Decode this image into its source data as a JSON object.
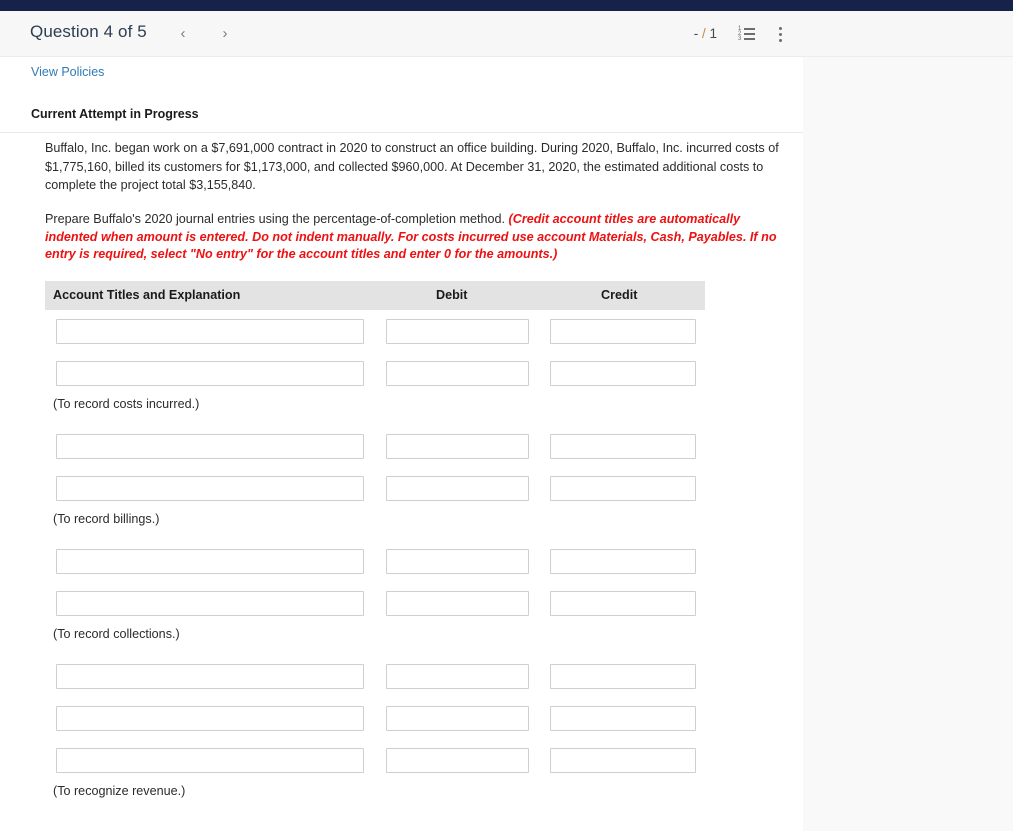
{
  "top_bar": {
    "color": "#16224a"
  },
  "header": {
    "title": "Question 4 of 5",
    "prev_label": "‹",
    "next_label": "›",
    "score_earned": "-",
    "score_separator": "/",
    "score_total": "1",
    "list_icon_name": "numbered-list-icon",
    "menu_icon_name": "kebab-menu-icon",
    "accent_color": "#c98a3a"
  },
  "content": {
    "view_policies_label": "View Policies",
    "attempt_status": "Current Attempt in Progress",
    "problem_text": "Buffalo, Inc. began work on a $7,691,000 contract in 2020 to construct an office building. During 2020, Buffalo, Inc. incurred costs of $1,775,160, billed its customers for $1,173,000, and collected $960,000. At December 31, 2020, the estimated additional costs to complete the project total $3,155,840.",
    "instruction_normal": "Prepare Buffalo's 2020 journal entries using the percentage-of-completion method. ",
    "instruction_red": "(Credit account titles are automatically indented when amount is entered. Do not indent manually. For costs incurred use account Materials, Cash, Payables. If no entry is required, select \"No entry\" for the account titles and enter 0 for the amounts.)",
    "instruction_red_color": "#ee1111"
  },
  "journal_table": {
    "columns": {
      "account": "Account Titles and Explanation",
      "debit": "Debit",
      "credit": "Credit"
    },
    "groups": [
      {
        "caption": "(To record costs incurred.)",
        "rows": [
          {
            "account": "",
            "debit": "",
            "credit": ""
          },
          {
            "account": "",
            "debit": "",
            "credit": ""
          }
        ]
      },
      {
        "caption": "(To record billings.)",
        "rows": [
          {
            "account": "",
            "debit": "",
            "credit": ""
          },
          {
            "account": "",
            "debit": "",
            "credit": ""
          }
        ]
      },
      {
        "caption": "(To record collections.)",
        "rows": [
          {
            "account": "",
            "debit": "",
            "credit": ""
          },
          {
            "account": "",
            "debit": "",
            "credit": ""
          }
        ]
      },
      {
        "caption": "(To recognize revenue.)",
        "rows": [
          {
            "account": "",
            "debit": "",
            "credit": ""
          },
          {
            "account": "",
            "debit": "",
            "credit": ""
          },
          {
            "account": "",
            "debit": "",
            "credit": ""
          }
        ]
      }
    ]
  }
}
